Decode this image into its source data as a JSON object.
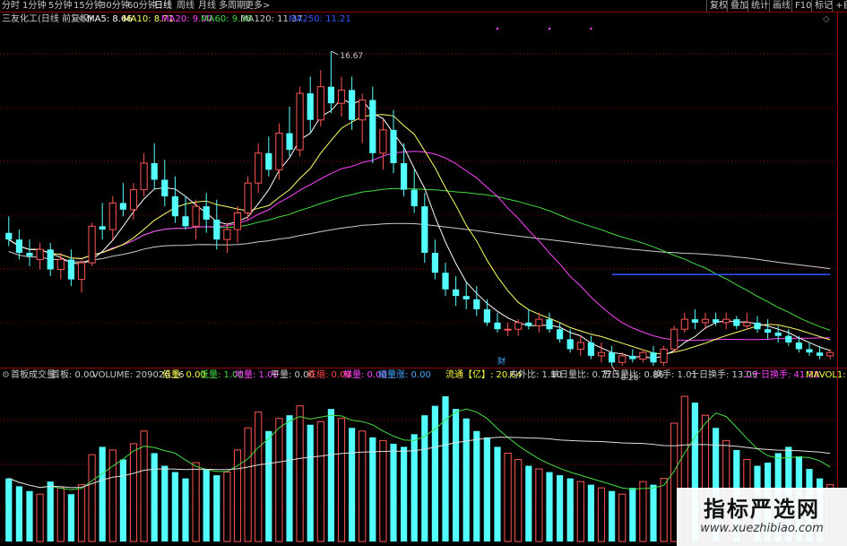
{
  "toolbar": {
    "periods": [
      "分时",
      "1分钟",
      "5分钟",
      "15分钟",
      "30分钟",
      "60分钟",
      "日线",
      "周线",
      "月线",
      "多周期",
      "更多>"
    ],
    "active_period": "日线",
    "right_buttons": [
      "复权",
      "叠加",
      "统计",
      "画线",
      "F10",
      "标记",
      "+自"
    ]
  },
  "price_panel": {
    "title": "三友化工(日线 前复权)",
    "ma": [
      {
        "label": "MA5: 8.66",
        "color": "#ffffff"
      },
      {
        "label": "MA10: 8.71",
        "color": "#ffff66"
      },
      {
        "label": "MA20: 9.00",
        "color": "#ff44ff"
      },
      {
        "label": "MA60: 9.36",
        "color": "#44dd44"
      },
      {
        "label": "MA120: 11.37",
        "color": "#cccccc"
      },
      {
        "label": "MA250: 11.21",
        "color": "#3355ff"
      }
    ],
    "high_label": "16.67",
    "low_label": "8.28",
    "marker_label": "财"
  },
  "volume_panel": {
    "items": [
      {
        "label": "首板成交量",
        "color": "#cccccc"
      },
      {
        "label": "首板: 0.00",
        "color": "#cccccc"
      },
      {
        "label": "VOLUME: 209026.16",
        "color": "#cccccc"
      },
      {
        "label": "倍量: 0.00",
        "color": "#ffff44"
      },
      {
        "label": "低量: 1.00",
        "color": "#44dd44"
      },
      {
        "label": "地量: 1.00",
        "color": "#ff44ff"
      },
      {
        "label": "平量: 0.00",
        "color": "#cccccc"
      },
      {
        "label": "底缩: 0.00",
        "color": "#ff4444"
      },
      {
        "label": "梯量: 0.00",
        "color": "#ff44ff"
      },
      {
        "label": "缩量涨: 0.00",
        "color": "#44aaff"
      },
      {
        "label": "流通【亿】: 20.64",
        "color": "#ffff44"
      },
      {
        "label": "内外比: 1.10",
        "color": "#cccccc"
      },
      {
        "label": "单日量比: 0.77",
        "color": "#cccccc"
      },
      {
        "label": "五日量比: 0.86",
        "color": "#cccccc"
      },
      {
        "label": "换手: 1.01",
        "color": "#cccccc"
      },
      {
        "label": "十日换手: 13.09",
        "color": "#cccccc"
      },
      {
        "label": "二十日换手: 41.28",
        "color": "#ff44ff"
      },
      {
        "label": "MAVOL1: 23",
        "color": "#ffff44"
      }
    ]
  },
  "watermark": {
    "title": "指标严选网",
    "url": "www.xuezhibiao.com"
  },
  "colors": {
    "up": "#ff5555",
    "down": "#54ffff",
    "grid": "#8b0000",
    "ma5": "#ffffff",
    "ma10": "#ffff66",
    "ma20": "#ff44ff",
    "ma60": "#44dd44",
    "ma120": "#cccccc",
    "ma250": "#3355ff"
  },
  "chart_data": {
    "type": "candlestick",
    "title": "三友化工(日线 前复权)",
    "ylim": [
      7.2,
      17.4
    ],
    "candles": [
      [
        11.2,
        11.7,
        10.8,
        11.0
      ],
      [
        11.0,
        11.3,
        10.4,
        10.6
      ],
      [
        10.6,
        11.0,
        10.2,
        10.5
      ],
      [
        10.4,
        10.9,
        10.1,
        10.7
      ],
      [
        10.7,
        10.9,
        9.9,
        10.1
      ],
      [
        10.1,
        10.6,
        9.8,
        10.4
      ],
      [
        10.4,
        10.7,
        9.6,
        9.8
      ],
      [
        9.8,
        10.4,
        9.4,
        10.3
      ],
      [
        10.3,
        11.5,
        10.2,
        11.4
      ],
      [
        11.4,
        12.1,
        11.0,
        11.3
      ],
      [
        11.3,
        12.3,
        11.0,
        12.1
      ],
      [
        12.1,
        12.7,
        11.7,
        11.9
      ],
      [
        11.9,
        12.7,
        11.6,
        12.5
      ],
      [
        12.5,
        13.6,
        12.3,
        13.3
      ],
      [
        13.3,
        13.9,
        12.5,
        12.8
      ],
      [
        12.8,
        13.4,
        12.0,
        12.3
      ],
      [
        12.3,
        12.9,
        11.5,
        11.7
      ],
      [
        11.7,
        12.3,
        11.3,
        11.4
      ],
      [
        11.4,
        12.2,
        11.0,
        12.0
      ],
      [
        12.0,
        12.4,
        11.2,
        11.6
      ],
      [
        11.6,
        12.2,
        10.7,
        11.0
      ],
      [
        11.0,
        11.5,
        10.6,
        11.3
      ],
      [
        11.3,
        12.0,
        10.9,
        11.8
      ],
      [
        11.8,
        12.9,
        11.6,
        12.7
      ],
      [
        12.7,
        13.9,
        12.4,
        13.6
      ],
      [
        13.6,
        14.1,
        12.9,
        13.1
      ],
      [
        13.1,
        14.5,
        12.8,
        14.2
      ],
      [
        14.2,
        15.0,
        13.5,
        13.7
      ],
      [
        13.7,
        15.6,
        13.5,
        15.4
      ],
      [
        15.4,
        15.9,
        14.2,
        14.6
      ],
      [
        14.6,
        16.1,
        14.4,
        15.6
      ],
      [
        15.6,
        16.67,
        14.8,
        15.1
      ],
      [
        15.1,
        15.9,
        14.7,
        15.5
      ],
      [
        15.5,
        15.9,
        14.3,
        14.6
      ],
      [
        14.6,
        15.4,
        13.9,
        15.2
      ],
      [
        15.2,
        15.6,
        13.3,
        13.6
      ],
      [
        13.6,
        14.6,
        13.1,
        14.3
      ],
      [
        14.3,
        14.9,
        13.0,
        13.3
      ],
      [
        13.3,
        13.9,
        12.3,
        12.5
      ],
      [
        12.5,
        13.1,
        11.8,
        12.0
      ],
      [
        12.0,
        12.4,
        10.3,
        10.6
      ],
      [
        10.6,
        11.0,
        9.8,
        10.0
      ],
      [
        10.0,
        10.3,
        9.3,
        9.5
      ],
      [
        9.5,
        9.9,
        9.0,
        9.3
      ],
      [
        9.3,
        9.7,
        8.9,
        9.2
      ],
      [
        9.2,
        9.6,
        8.7,
        8.9
      ],
      [
        8.9,
        9.2,
        8.4,
        8.5
      ],
      [
        8.5,
        8.8,
        8.2,
        8.3
      ],
      [
        8.3,
        8.5,
        8.1,
        8.3
      ],
      [
        8.3,
        8.6,
        8.1,
        8.5
      ],
      [
        8.5,
        8.9,
        8.3,
        8.4
      ],
      [
        8.4,
        8.8,
        8.2,
        8.6
      ],
      [
        8.6,
        8.8,
        8.2,
        8.3
      ],
      [
        8.3,
        8.5,
        7.9,
        8.0
      ],
      [
        8.0,
        8.3,
        7.6,
        7.7
      ],
      [
        7.7,
        8.1,
        7.5,
        7.9
      ],
      [
        7.9,
        8.1,
        7.4,
        7.5
      ],
      [
        7.5,
        7.9,
        7.3,
        7.6
      ],
      [
        7.6,
        7.8,
        7.2,
        7.3
      ],
      [
        7.3,
        7.6,
        7.2,
        7.5
      ],
      [
        7.5,
        7.7,
        7.3,
        7.4
      ],
      [
        7.4,
        7.7,
        7.3,
        7.6
      ],
      [
        7.6,
        7.8,
        7.2,
        7.3
      ],
      [
        7.3,
        7.8,
        7.2,
        7.7
      ],
      [
        7.7,
        8.4,
        7.6,
        8.3
      ],
      [
        8.3,
        8.8,
        8.2,
        8.6
      ],
      [
        8.6,
        8.9,
        8.3,
        8.5
      ],
      [
        8.5,
        8.8,
        8.3,
        8.6
      ],
      [
        8.6,
        8.8,
        8.4,
        8.5
      ],
      [
        8.5,
        8.8,
        8.3,
        8.6
      ],
      [
        8.6,
        8.7,
        8.3,
        8.4
      ],
      [
        8.4,
        8.8,
        8.3,
        8.5
      ],
      [
        8.5,
        8.7,
        8.2,
        8.3
      ],
      [
        8.3,
        8.6,
        8.0,
        8.2
      ],
      [
        8.2,
        8.4,
        7.9,
        8.1
      ],
      [
        8.1,
        8.3,
        7.8,
        7.9
      ],
      [
        7.9,
        8.1,
        7.6,
        7.7
      ],
      [
        7.7,
        7.9,
        7.5,
        7.6
      ],
      [
        7.6,
        7.8,
        7.4,
        7.5
      ],
      [
        7.5,
        7.7,
        7.4,
        7.6
      ]
    ],
    "volume": [
      40,
      35,
      32,
      30,
      38,
      34,
      30,
      36,
      55,
      60,
      58,
      52,
      62,
      70,
      56,
      48,
      44,
      40,
      50,
      46,
      42,
      44,
      58,
      72,
      82,
      70,
      78,
      80,
      86,
      74,
      76,
      84,
      78,
      72,
      70,
      66,
      64,
      62,
      60,
      68,
      80,
      86,
      92,
      84,
      78,
      70,
      66,
      60,
      56,
      52,
      48,
      46,
      44,
      42,
      40,
      38,
      36,
      34,
      32,
      30,
      34,
      38,
      36,
      40,
      75,
      92,
      88,
      80,
      72,
      64,
      58,
      52,
      48,
      50,
      56,
      60,
      54,
      46,
      40,
      36
    ],
    "volume_ylim": [
      0,
      100
    ]
  }
}
